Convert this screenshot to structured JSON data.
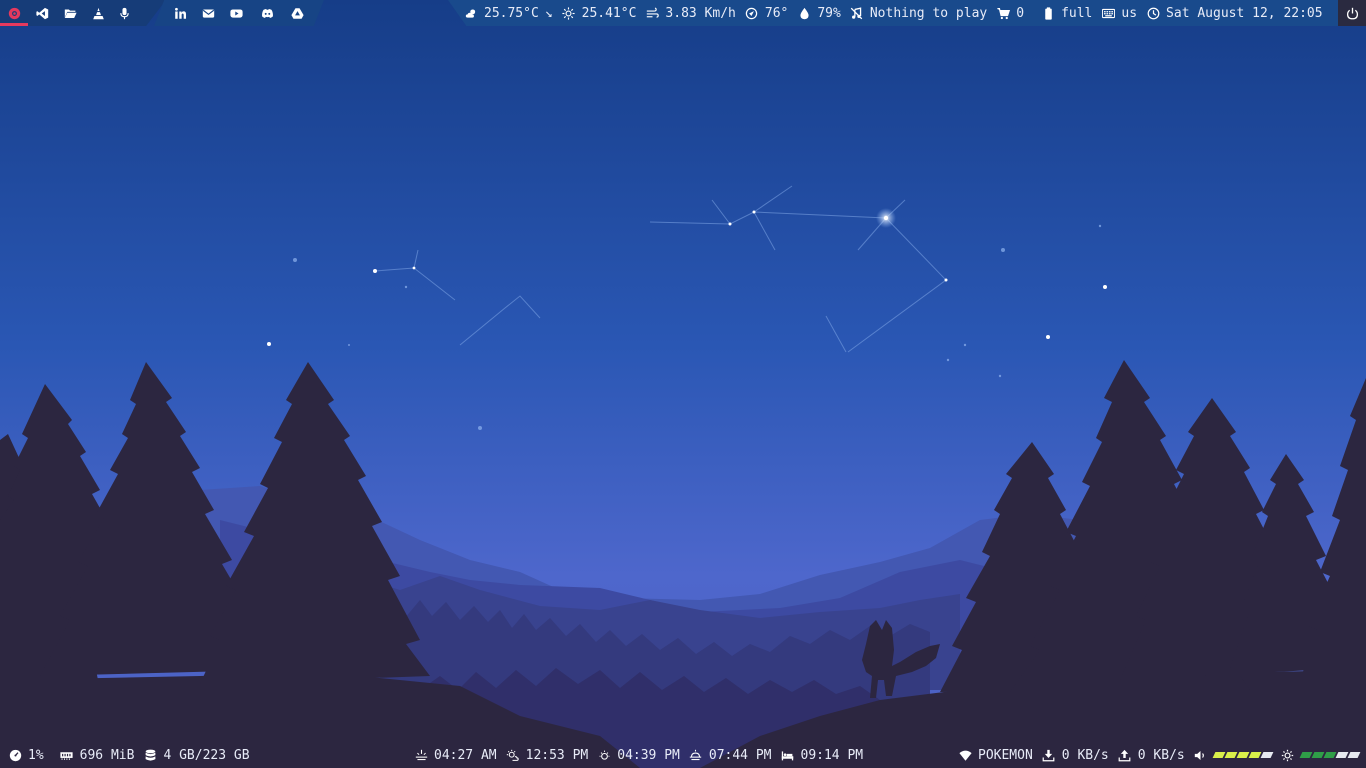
{
  "colors": {
    "sky_top": "#173f8a",
    "sky_bottom": "#4b64c8",
    "tree_dark": "#2c2640",
    "active_accent": "#e5395e",
    "volume_bar": "#d9f04a",
    "brightness_bar": "#2f9e48",
    "bar_empty": "#e6e9f0",
    "status_panel": "#194a8c"
  },
  "top_bar": {
    "launchers": [
      {
        "name": "browser-icon",
        "active": true
      },
      {
        "name": "vscode-icon"
      },
      {
        "name": "folder-icon"
      },
      {
        "name": "vlc-icon"
      },
      {
        "name": "microphone-icon"
      }
    ],
    "social": [
      {
        "name": "linkedin-icon"
      },
      {
        "name": "mail-icon"
      },
      {
        "name": "youtube-icon"
      },
      {
        "name": "discord-icon"
      },
      {
        "name": "drive-icon"
      }
    ],
    "weather": {
      "temperature": "25.75°C",
      "trend_icon": "↘",
      "feels_like": "25.41°C",
      "wind": "3.83 Km/h",
      "wind_direction": "76°",
      "humidity": "79%"
    },
    "music": {
      "text": "Nothing to play"
    },
    "updates": {
      "count": "0"
    },
    "battery": {
      "text": "full"
    },
    "keyboard": {
      "layout": "us"
    },
    "clock": {
      "text": "Sat August 12, 22:05"
    }
  },
  "bottom_bar": {
    "cpu": "1%",
    "memory": "696 MiB",
    "disk": "4 GB/223 GB",
    "sun_times": {
      "dawn": "04:27 AM",
      "noon": "12:53 PM",
      "afternoon": "04:39 PM",
      "sunset": "07:44 PM",
      "night": "09:14 PM"
    },
    "network": {
      "ssid": "POKEMON",
      "download": "0 KB/s",
      "upload": "0 KB/s"
    },
    "volume": {
      "level": 0.8,
      "segments": 5
    },
    "brightness": {
      "level": 0.6,
      "segments": 5
    }
  }
}
